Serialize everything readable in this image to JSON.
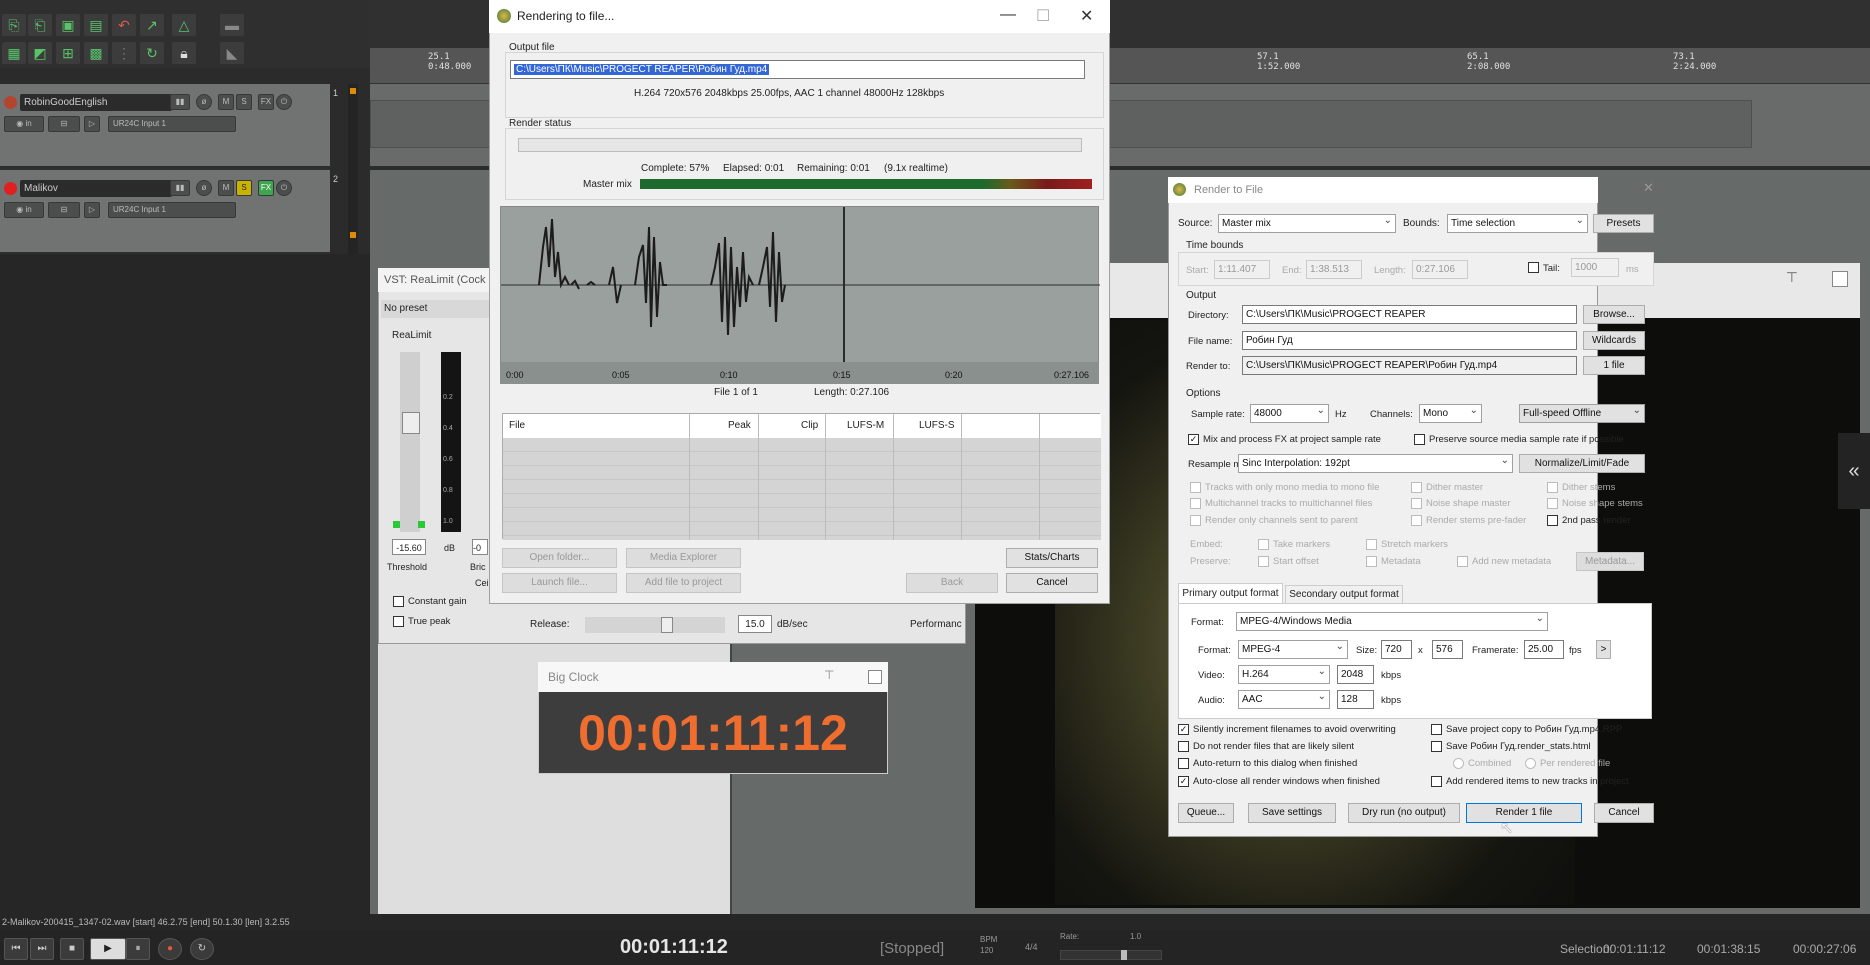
{
  "reaper": {
    "ruler_marks": [
      {
        "label": "25.1",
        "sub": "0:48.000"
      },
      {
        "label": "57.1",
        "sub": "1:52.000"
      },
      {
        "label": "65.1",
        "sub": "2:08.000"
      },
      {
        "label": "73.1",
        "sub": "2:24.000"
      }
    ],
    "tracks": [
      {
        "name": "RobinGoodEnglish",
        "input": "UR24C Input 1",
        "num": "1",
        "dot_color": "#b3452f"
      },
      {
        "name": "Malikov",
        "input": "UR24C Input 1",
        "num": "2",
        "dot_color": "#e02020"
      }
    ],
    "status_line": "2-Malikov-200415_1347-02.wav [start] 46.2.75 [end] 50.1.30 [len] 3.2.55",
    "transport": {
      "time": "00:01:11:12",
      "state": "[Stopped]",
      "bpm_label": "BPM",
      "bpm": "120",
      "sig": "4/4",
      "rate_label": "Rate:",
      "rate": "1.0",
      "selection_label": "Selection:",
      "sel_start": "00:01:11:12",
      "sel_end": "00:01:38:15",
      "sel_len": "00:00:27:06"
    }
  },
  "vst": {
    "title": "VST: ReaLimit (Cock",
    "preset": "No preset",
    "name": "ReaLimit",
    "threshold_value": "-15.60",
    "threshold_label": "Threshold",
    "db_label": "dB",
    "ceiling_value": "-0",
    "bric_label": "Bric",
    "cei_label": "Cei",
    "meter_scale": [
      "0.2",
      "0.4",
      "0.6",
      "0.8",
      "1.0"
    ],
    "constant_gain": "Constant gain",
    "true_peak": "True peak",
    "release_label": "Release:",
    "release_value": "15.0",
    "release_unit": "dB/sec",
    "performance": "Performanc"
  },
  "bigclock": {
    "title": "Big Clock",
    "time": "00:01:11:12"
  },
  "rendering": {
    "title": "Rendering to file...",
    "output_file_label": "Output file",
    "output_path": "C:\\Users\\ПК\\Music\\PROGECT REAPER\\Робин Гуд.mp4",
    "format_info": "H.264 720x576 2048kbps 25.00fps, AAC 1 channel 48000Hz 128kbps",
    "render_status_label": "Render status",
    "progress": 0.57,
    "complete": "Complete: 57%",
    "elapsed": "Elapsed: 0:01",
    "remaining": "Remaining: 0:01",
    "realtime": "(9.1x realtime)",
    "master_mix_label": "Master mix",
    "timeline_ticks": [
      "0:00",
      "0:05",
      "0:10",
      "0:15",
      "0:20",
      "0:27.106"
    ],
    "file_of": "File 1 of 1",
    "length": "Length: 0:27.106",
    "table_headers": [
      "File",
      "Peak",
      "Clip",
      "LUFS-M",
      "LUFS-S"
    ],
    "buttons": {
      "open_folder": "Open folder...",
      "media_explorer": "Media Explorer",
      "stats_charts": "Stats/Charts",
      "launch_file": "Launch file...",
      "add_to_project": "Add file to project",
      "back": "Back",
      "cancel": "Cancel"
    }
  },
  "rtf": {
    "title": "Render to File",
    "source_label": "Source:",
    "source": "Master mix",
    "bounds_label": "Bounds:",
    "bounds": "Time selection",
    "presets": "Presets",
    "time_bounds_label": "Time bounds",
    "start_label": "Start:",
    "start": "1:11.407",
    "end_label": "End:",
    "end": "1:38.513",
    "length_label": "Length:",
    "length": "0:27.106",
    "tail_label": "Tail:",
    "tail": "1000",
    "tail_unit": "ms",
    "output_label": "Output",
    "directory_label": "Directory:",
    "directory": "C:\\Users\\ПК\\Music\\PROGECT REAPER",
    "browse": "Browse...",
    "file_name_label": "File name:",
    "file_name": "Робин Гуд",
    "wildcards": "Wildcards",
    "render_to_label": "Render to:",
    "render_to": "C:\\Users\\ПК\\Music\\PROGECT REAPER\\Робин Гуд.mp4",
    "one_file": "1 file",
    "options_label": "Options",
    "sample_rate_label": "Sample rate:",
    "sample_rate": "48000",
    "hz": "Hz",
    "channels_label": "Channels:",
    "channels": "Mono",
    "speed": "Full-speed Offline",
    "mix_fx": "Mix and process FX at project sample rate",
    "preserve_sr": "Preserve source media sample rate if possible",
    "resample_label": "Resample mode:",
    "resample": "Sinc Interpolation: 192pt",
    "normalize": "Normalize/Limit/Fade",
    "opt_mono": "Tracks with only mono media to mono file",
    "opt_multich": "Multichannel tracks to multichannel files",
    "opt_sent": "Render only channels sent to parent",
    "dither_master": "Dither master",
    "noise_master": "Noise shape master",
    "stems_prefader": "Render stems pre-fader",
    "dither_stems": "Dither stems",
    "noise_stems": "Noise shape stems",
    "second_pass": "2nd pass render",
    "embed_label": "Embed:",
    "take_markers": "Take markers",
    "stretch_markers": "Stretch markers",
    "preserve_label": "Preserve:",
    "start_offset": "Start offset",
    "metadata_chk": "Metadata",
    "add_metadata": "Add new metadata",
    "metadata_btn": "Metadata...",
    "tab_primary": "Primary output format",
    "tab_secondary": "Secondary output format",
    "format_label": "Format:",
    "format": "MPEG-4/Windows Media",
    "sub_format_label": "Format:",
    "sub_format": "MPEG-4",
    "size_label": "Size:",
    "width": "720",
    "x": "x",
    "height": "576",
    "framerate_label": "Framerate:",
    "framerate": "25.00",
    "fps": "fps",
    "video_label": "Video:",
    "video_codec": "H.264",
    "video_kbps": "2048",
    "kbps": "kbps",
    "audio_label": "Audio:",
    "audio_codec": "AAC",
    "audio_kbps": "128",
    "silently_increment": "Silently increment filenames to avoid overwriting",
    "save_copy": "Save project copy to Робин Гуд.mp4.RPP",
    "no_silent": "Do not render files that are likely silent",
    "save_stats": "Save Робин Гуд.render_stats.html",
    "auto_return": "Auto-return to this dialog when finished",
    "combined": "Combined",
    "per_rendered": "Per rendered file",
    "auto_close": "Auto-close all render windows when finished",
    "add_rendered": "Add rendered items to new tracks in project",
    "queue": "Queue...",
    "save_settings": "Save settings",
    "dry_run": "Dry run (no output)",
    "render": "Render 1 file",
    "cancel": "Cancel"
  }
}
